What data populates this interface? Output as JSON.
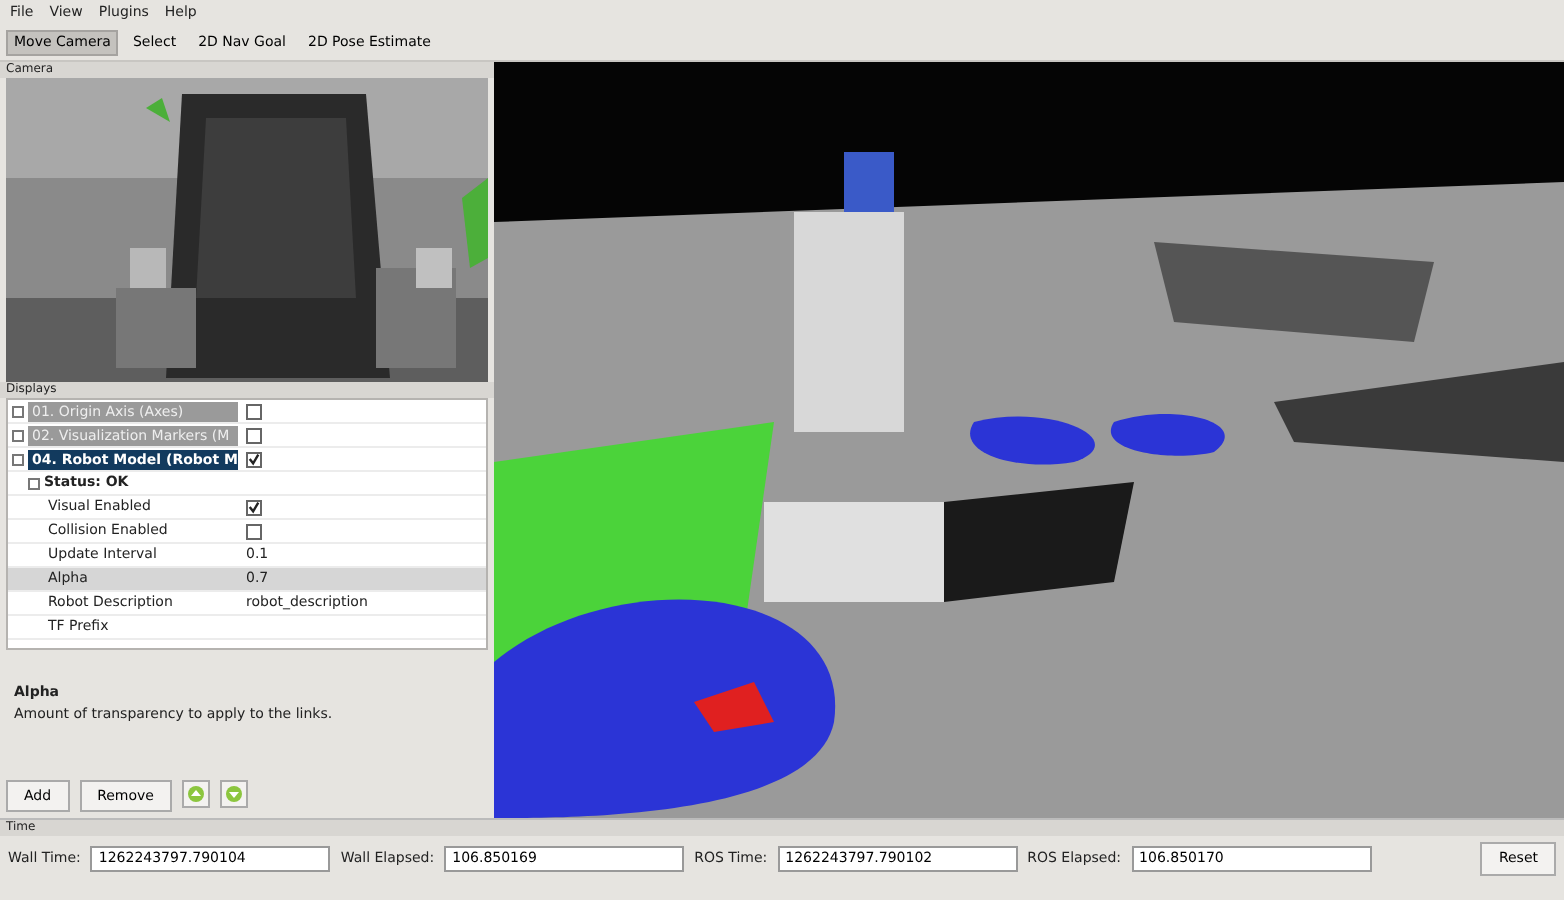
{
  "menu": [
    "File",
    "View",
    "Plugins",
    "Help"
  ],
  "tools": [
    {
      "label": "Move Camera",
      "selected": true
    },
    {
      "label": "Select",
      "selected": false
    },
    {
      "label": "2D Nav Goal",
      "selected": false
    },
    {
      "label": "2D Pose Estimate",
      "selected": false
    }
  ],
  "camera_panel": {
    "title": "Camera"
  },
  "displays_panel": {
    "title": "Displays",
    "displays": [
      {
        "label": "01. Origin Axis (Axes)",
        "checked": false,
        "selected": false
      },
      {
        "label": "02. Visualization Markers (M",
        "checked": false,
        "selected": false
      },
      {
        "label": "04. Robot Model (Robot M",
        "checked": true,
        "selected": true
      }
    ],
    "status": "Status: OK",
    "properties": [
      {
        "kind": "checkbox",
        "label": "Visual Enabled",
        "checked": true,
        "selected": false
      },
      {
        "kind": "checkbox",
        "label": "Collision Enabled",
        "checked": false,
        "selected": false
      },
      {
        "kind": "value",
        "label": "Update Interval",
        "value": "0.1",
        "selected": false
      },
      {
        "kind": "value",
        "label": "Alpha",
        "value": "0.7",
        "selected": true
      },
      {
        "kind": "value",
        "label": "Robot Description",
        "value": "robot_description",
        "selected": false
      },
      {
        "kind": "value",
        "label": "TF Prefix",
        "selected": false
      }
    ],
    "help_title": "Alpha",
    "help_text": "Amount of transparency to apply to the links.",
    "buttons": [
      "Add",
      "Remove"
    ]
  },
  "time_panel": {
    "title": "Time",
    "fields": [
      {
        "label": "Wall Time:",
        "value": "1262243797.790104"
      },
      {
        "label": "Wall Elapsed:",
        "value": "106.850169"
      },
      {
        "label": "ROS Time:",
        "value": "1262243797.790102"
      },
      {
        "label": "ROS Elapsed:",
        "value": "106.850170"
      }
    ],
    "button": "Reset"
  }
}
